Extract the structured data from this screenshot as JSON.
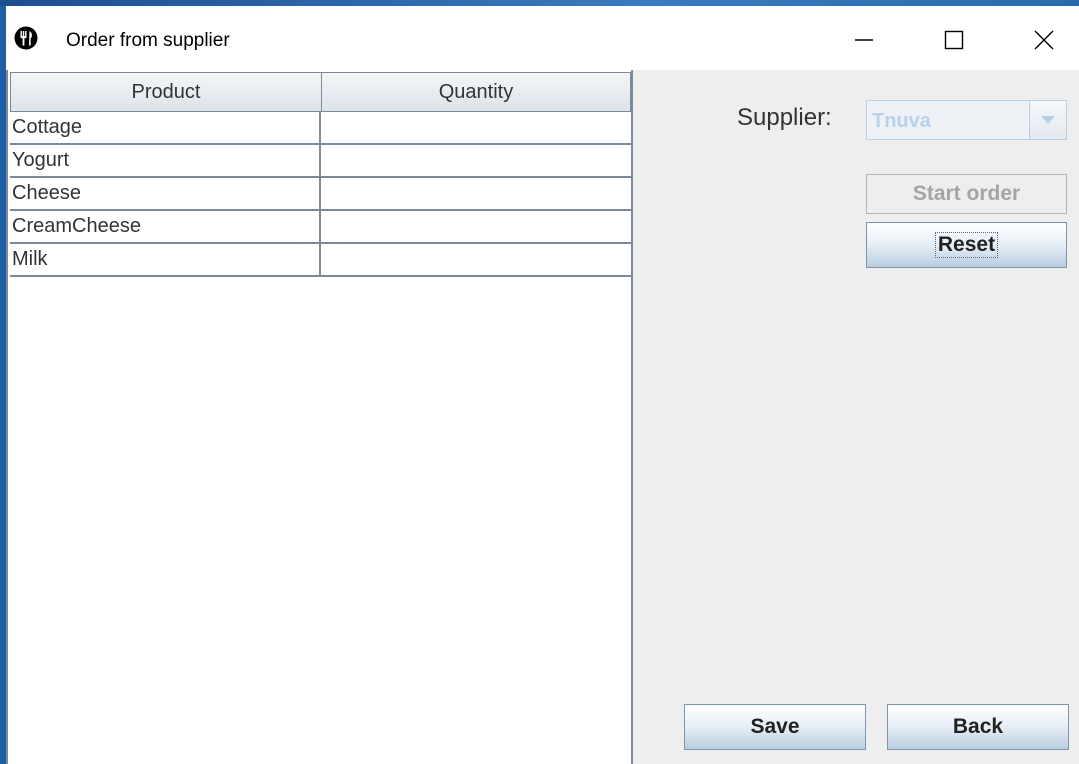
{
  "window": {
    "title": "Order from supplier",
    "app_icon": "utensils-icon",
    "controls": [
      "minimize-icon",
      "maximize-icon",
      "close-icon"
    ]
  },
  "table": {
    "columns": [
      "Product",
      "Quantity"
    ],
    "rows": [
      {
        "product": "Cottage",
        "quantity": ""
      },
      {
        "product": "Yogurt",
        "quantity": ""
      },
      {
        "product": "Cheese",
        "quantity": ""
      },
      {
        "product": "CreamCheese",
        "quantity": ""
      },
      {
        "product": "Milk",
        "quantity": ""
      }
    ]
  },
  "supplier": {
    "label": "Supplier:",
    "selected": "Tnuva"
  },
  "buttons": {
    "start_order": "Start order",
    "reset": "Reset",
    "save": "Save",
    "back": "Back"
  },
  "colors": {
    "accent_blue": "#1f5fa8",
    "grid_line": "#7a8a9a",
    "disabled_text": "#a5a5a5"
  }
}
